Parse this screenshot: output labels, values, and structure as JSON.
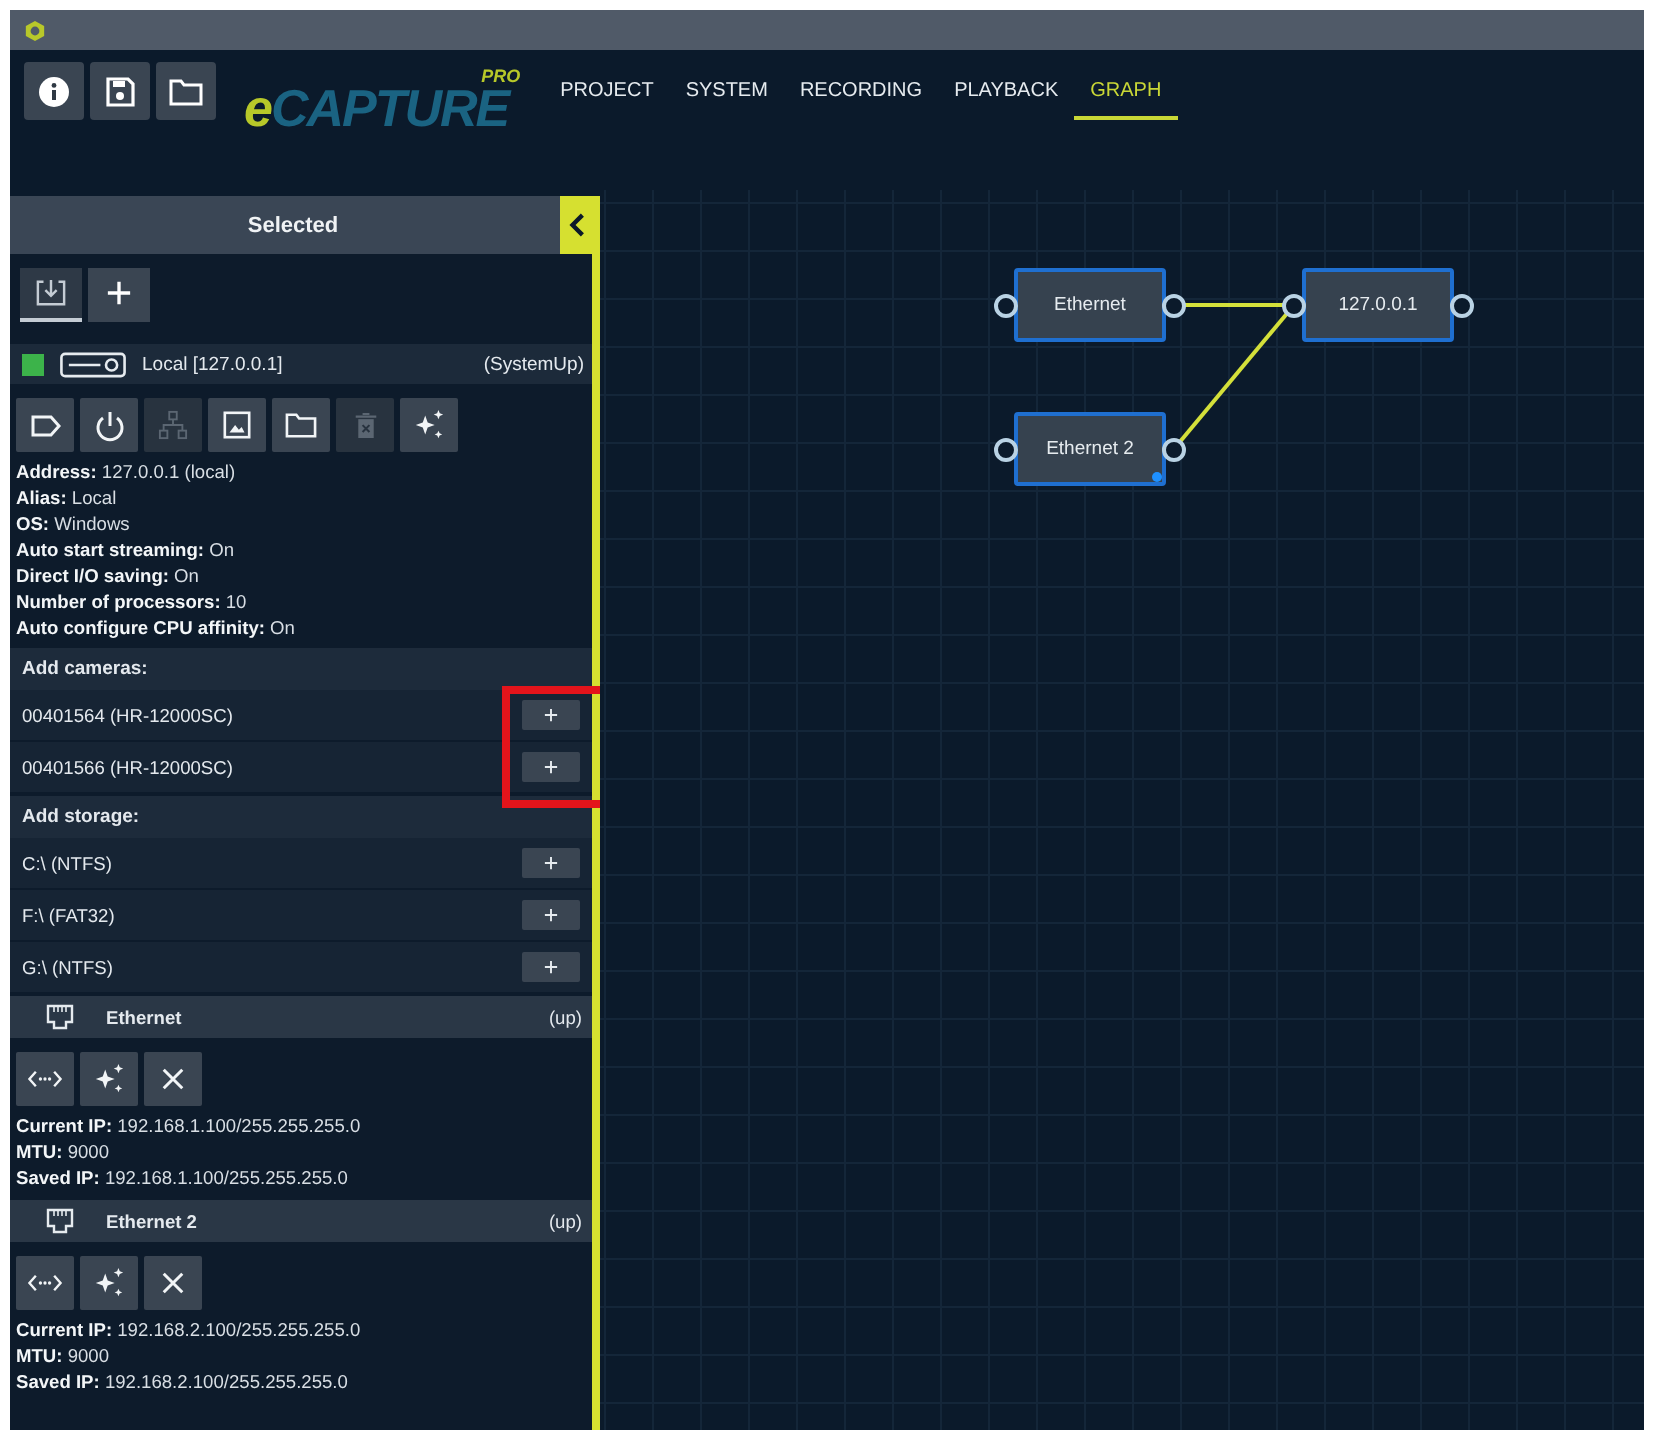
{
  "header": {
    "logo": {
      "prefix": "e",
      "main": "CAPTURE",
      "badge": "PRO"
    },
    "tabs": [
      {
        "label": "PROJECT",
        "selected": false
      },
      {
        "label": "SYSTEM",
        "selected": false
      },
      {
        "label": "RECORDING",
        "selected": false
      },
      {
        "label": "PLAYBACK",
        "selected": false
      },
      {
        "label": "GRAPH",
        "selected": true
      }
    ]
  },
  "sidebar": {
    "title": "Selected",
    "tabs": [
      {
        "selected": true
      },
      {
        "selected": false
      }
    ],
    "system": {
      "online": true,
      "name": "Local [127.0.0.1]",
      "state": "(SystemUp)"
    },
    "tools": [
      {
        "disabled": false
      },
      {
        "disabled": false
      },
      {
        "disabled": true
      },
      {
        "disabled": false
      },
      {
        "disabled": false
      },
      {
        "disabled": true
      },
      {
        "disabled": false
      }
    ],
    "properties": [
      {
        "label": "Address:",
        "value": "127.0.0.1 (local)"
      },
      {
        "label": "Alias:",
        "value": "Local"
      },
      {
        "label": "OS:",
        "value": "Windows"
      },
      {
        "label": "Auto start streaming:",
        "value": "On"
      },
      {
        "label": "Direct I/O saving:",
        "value": "On"
      },
      {
        "label": "Number of processors:",
        "value": "10"
      },
      {
        "label": "Auto configure CPU affinity:",
        "value": "On"
      }
    ],
    "cameras": {
      "title": "Add cameras:",
      "highlighted": true,
      "items": [
        {
          "name": "00401564 (HR-12000SC)"
        },
        {
          "name": "00401566 (HR-12000SC)"
        }
      ]
    },
    "storage": {
      "title": "Add storage:",
      "items": [
        {
          "name": "C:\\ (NTFS)"
        },
        {
          "name": "F:\\ (FAT32)"
        },
        {
          "name": "G:\\ (NTFS)"
        }
      ]
    },
    "interfaces": [
      {
        "name": "Ethernet",
        "state": "(up)",
        "properties": [
          {
            "label": "Current IP:",
            "value": "192.168.1.100/255.255.255.0"
          },
          {
            "label": "MTU:",
            "value": "9000"
          },
          {
            "label": "Saved IP:",
            "value": "192.168.1.100/255.255.255.0"
          }
        ]
      },
      {
        "name": "Ethernet 2",
        "state": "(up)",
        "properties": [
          {
            "label": "Current IP:",
            "value": "192.168.2.100/255.255.255.0"
          },
          {
            "label": "MTU:",
            "value": "9000"
          },
          {
            "label": "Saved IP:",
            "value": "192.168.2.100/255.255.255.0"
          }
        ]
      }
    ]
  },
  "graph": {
    "nodes": [
      {
        "label": "Ethernet",
        "resize_handle": false
      },
      {
        "label": "127.0.0.1",
        "resize_handle": false
      },
      {
        "label": "Ethernet 2",
        "resize_handle": true
      }
    ]
  }
}
